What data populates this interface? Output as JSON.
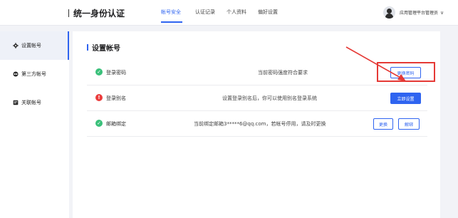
{
  "header": {
    "brand": "统一身份认证",
    "nav": [
      "帐号安全",
      "认证记录",
      "个人资料",
      "偏好设置"
    ],
    "user_name": "应用管理平台管理员",
    "chevron": "∨"
  },
  "sidebar": {
    "items": [
      {
        "label": "设置帐号",
        "icon": "gear-icon",
        "active": true
      },
      {
        "label": "第三方帐号",
        "icon": "link-icon",
        "active": false
      },
      {
        "label": "关联帐号",
        "icon": "account-icon",
        "active": false
      }
    ]
  },
  "main": {
    "title": "设置帐号",
    "rows": [
      {
        "status": "ok",
        "label": "登录密码",
        "desc": "当前密码强度符合要求"
      },
      {
        "status": "warn",
        "label": "登录别名",
        "desc": "设置登录别名后，你可以使用别名登录系统"
      },
      {
        "status": "ok",
        "label": "邮箱绑定",
        "desc": "当前绑定邮箱3*****6@qq.com，若帐号停用，请及时更换"
      }
    ]
  },
  "actions": {
    "change_password": "更换密码",
    "set_now": "立即设置",
    "replace": "更换",
    "unbind": "解绑"
  },
  "colors": {
    "accent": "#2f64f0",
    "success": "#3ac07a",
    "warning": "#eb3c3c",
    "annotation": "#e53935"
  }
}
